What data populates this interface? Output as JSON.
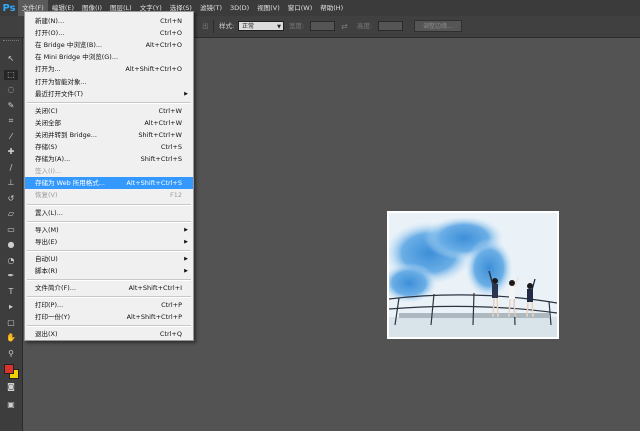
{
  "app": {
    "logo": "Ps"
  },
  "menubar": {
    "items": [
      {
        "label": "文件(F)",
        "active": true
      },
      {
        "label": "编辑(E)"
      },
      {
        "label": "图像(I)"
      },
      {
        "label": "图层(L)"
      },
      {
        "label": "文字(Y)"
      },
      {
        "label": "选择(S)"
      },
      {
        "label": "滤镜(T)"
      },
      {
        "label": "3D(D)"
      },
      {
        "label": "视图(V)"
      },
      {
        "label": "窗口(W)"
      },
      {
        "label": "帮助(H)"
      }
    ]
  },
  "options": {
    "partial_label": "出",
    "style_label": "样式:",
    "style_value": "正常",
    "width_label": "宽度:",
    "height_label": "高度:",
    "adjust_edge_label": "调整边缘..."
  },
  "file_menu": {
    "items": [
      {
        "label": "新建(N)...",
        "shortcut": "Ctrl+N"
      },
      {
        "label": "打开(O)...",
        "shortcut": "Ctrl+O"
      },
      {
        "label": "在 Bridge 中浏览(B)...",
        "shortcut": "Alt+Ctrl+O"
      },
      {
        "label": "在 Mini Bridge 中浏览(G)...",
        "shortcut": ""
      },
      {
        "label": "打开为...",
        "shortcut": "Alt+Shift+Ctrl+O"
      },
      {
        "label": "打开为智能对象...",
        "shortcut": ""
      },
      {
        "label": "最近打开文件(T)",
        "shortcut": "",
        "submenu": true
      },
      {
        "separator": true
      },
      {
        "label": "关闭(C)",
        "shortcut": "Ctrl+W"
      },
      {
        "label": "关闭全部",
        "shortcut": "Alt+Ctrl+W"
      },
      {
        "label": "关闭并转到 Bridge...",
        "shortcut": "Shift+Ctrl+W"
      },
      {
        "label": "存储(S)",
        "shortcut": "Ctrl+S"
      },
      {
        "label": "存储为(A)...",
        "shortcut": "Shift+Ctrl+S"
      },
      {
        "label": "签入(I)...",
        "shortcut": "",
        "disabled": true
      },
      {
        "label": "存储为 Web 所用格式...",
        "shortcut": "Alt+Shift+Ctrl+S",
        "highlighted": true
      },
      {
        "label": "恢复(V)",
        "shortcut": "F12",
        "disabled": true
      },
      {
        "separator": true
      },
      {
        "label": "置入(L)...",
        "shortcut": ""
      },
      {
        "separator": true
      },
      {
        "label": "导入(M)",
        "shortcut": "",
        "submenu": true
      },
      {
        "label": "导出(E)",
        "shortcut": "",
        "submenu": true
      },
      {
        "separator": true
      },
      {
        "label": "自动(U)",
        "shortcut": "",
        "submenu": true
      },
      {
        "label": "脚本(R)",
        "shortcut": "",
        "submenu": true
      },
      {
        "separator": true
      },
      {
        "label": "文件简介(F)...",
        "shortcut": "Alt+Shift+Ctrl+I"
      },
      {
        "separator": true
      },
      {
        "label": "打印(P)...",
        "shortcut": "Ctrl+P"
      },
      {
        "label": "打印一份(Y)",
        "shortcut": "Alt+Shift+Ctrl+P"
      },
      {
        "separator": true
      },
      {
        "label": "退出(X)",
        "shortcut": "Ctrl+Q"
      }
    ]
  },
  "tools": [
    {
      "icon": "move-icon",
      "glyph": "↖"
    },
    {
      "icon": "marquee-icon",
      "glyph": "⬚",
      "selected": true
    },
    {
      "icon": "lasso-icon",
      "glyph": "◌"
    },
    {
      "icon": "quick-select-icon",
      "glyph": "✎"
    },
    {
      "icon": "crop-icon",
      "glyph": "⌗"
    },
    {
      "icon": "eyedropper-icon",
      "glyph": "⁄"
    },
    {
      "icon": "healing-icon",
      "glyph": "✚"
    },
    {
      "icon": "brush-icon",
      "glyph": "∕"
    },
    {
      "icon": "stamp-icon",
      "glyph": "⊥"
    },
    {
      "icon": "history-brush-icon",
      "glyph": "↺"
    },
    {
      "icon": "eraser-icon",
      "glyph": "▱"
    },
    {
      "icon": "gradient-icon",
      "glyph": "▭"
    },
    {
      "icon": "blur-icon",
      "glyph": "●"
    },
    {
      "icon": "dodge-icon",
      "glyph": "◔"
    },
    {
      "icon": "pen-icon",
      "glyph": "✒"
    },
    {
      "icon": "type-icon",
      "glyph": "T"
    },
    {
      "icon": "path-select-icon",
      "glyph": "▸"
    },
    {
      "icon": "shape-icon",
      "glyph": "▢"
    },
    {
      "icon": "hand-icon",
      "glyph": "✋"
    },
    {
      "icon": "zoom-icon",
      "glyph": "⚲"
    }
  ],
  "colors": {
    "foreground": "#d9332b",
    "background": "#f5d000"
  }
}
